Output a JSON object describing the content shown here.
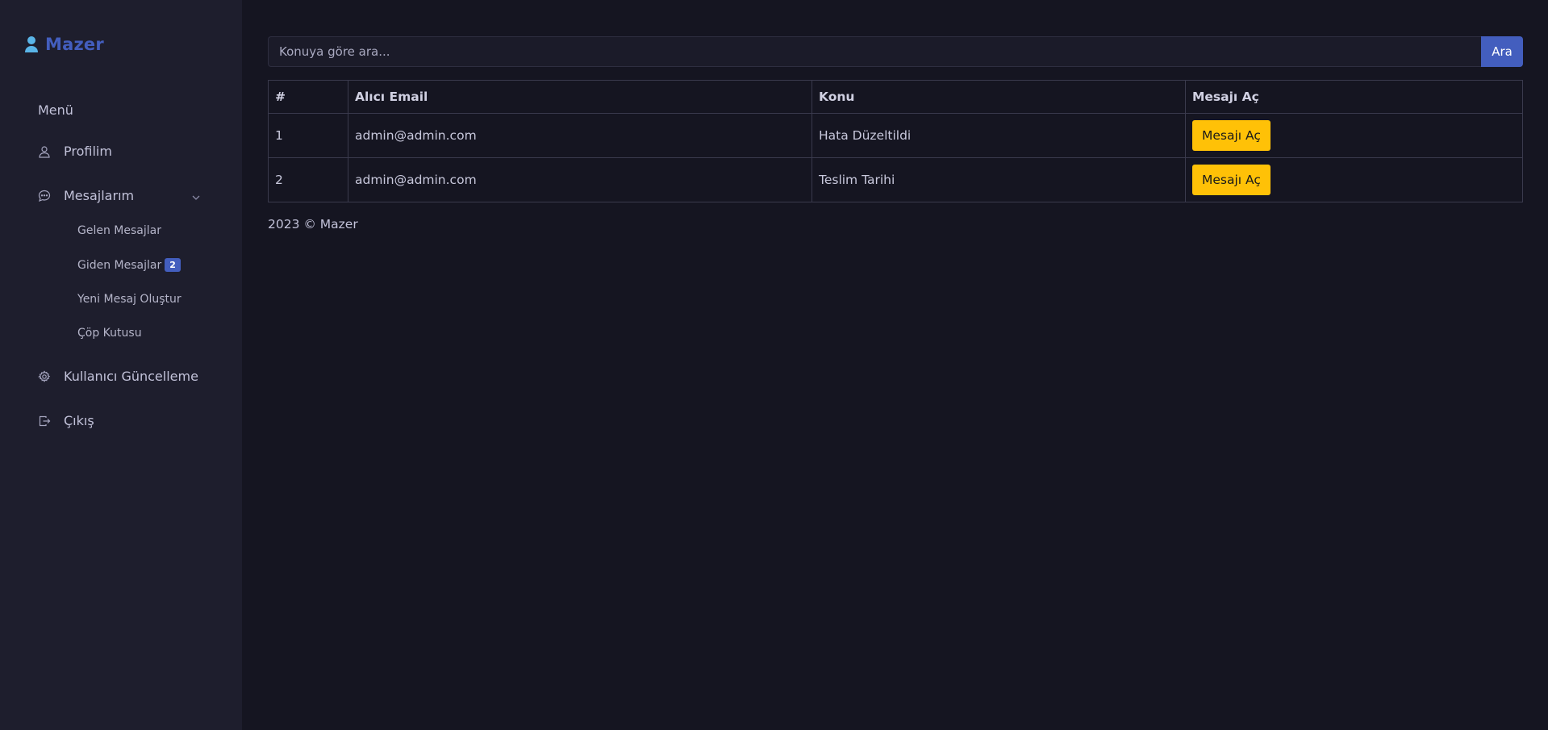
{
  "app": {
    "brand": "Mazer"
  },
  "sidebar": {
    "menu_title": "Menü",
    "items": [
      {
        "label": "Profilim",
        "icon": "person-icon"
      },
      {
        "label": "Mesajlarım",
        "icon": "chat-icon"
      },
      {
        "label": "Kullanıcı Güncelleme",
        "icon": "gear-icon"
      },
      {
        "label": "Çıkış",
        "icon": "logout-icon"
      }
    ],
    "submenu": [
      {
        "label": "Gelen Mesajlar"
      },
      {
        "label": "Giden Mesajlar",
        "badge": "2"
      },
      {
        "label": "Yeni Mesaj Oluştur"
      },
      {
        "label": "Çöp Kutusu"
      }
    ]
  },
  "search": {
    "placeholder": "Konuya göre ara...",
    "button_label": "Ara"
  },
  "table": {
    "headers": [
      "#",
      "Alıcı Email",
      "Konu",
      "Mesajı Aç"
    ],
    "rows": [
      {
        "num": "1",
        "email": "admin@admin.com",
        "subject": "Hata Düzeltildi",
        "action": "Mesajı Aç"
      },
      {
        "num": "2",
        "email": "admin@admin.com",
        "subject": "Teslim Tarihi",
        "action": "Mesajı Aç"
      }
    ]
  },
  "footer": {
    "text": "2023 © Mazer"
  },
  "colors": {
    "accent": "#435ebe",
    "warning": "#ffc107",
    "sidebar_bg": "#1e1e2d",
    "page_bg": "#151521"
  }
}
